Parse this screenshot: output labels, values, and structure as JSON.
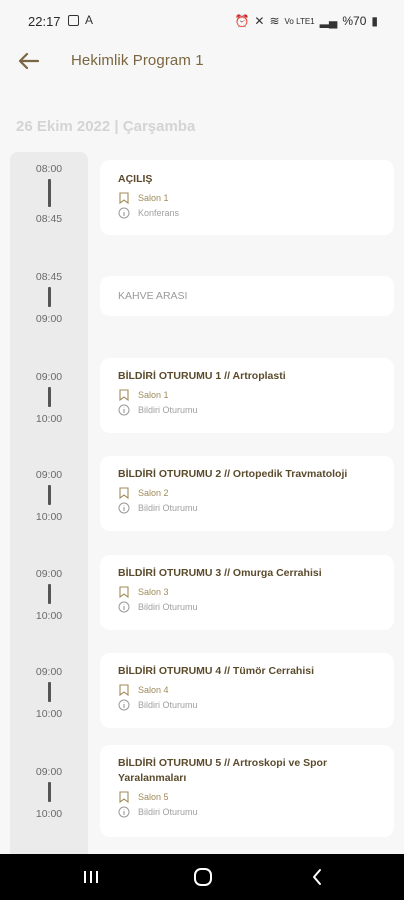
{
  "status": {
    "time": "22:17",
    "letter": "A",
    "net": "Vo LTE1",
    "battery": "%70"
  },
  "header": {
    "title": "Hekimlik Program 1"
  },
  "date_header": "26 Ekim 2022 | Çarşamba",
  "sessions": [
    {
      "start": "08:00",
      "end": "08:45",
      "title": "AÇILIŞ",
      "salon": "Salon 1",
      "type": "Konferans"
    },
    {
      "start": "08:45",
      "end": "09:00",
      "title": "KAHVE ARASI"
    },
    {
      "start": "09:00",
      "end": "10:00",
      "title": "BİLDİRİ OTURUMU 1 // Artroplasti",
      "salon": "Salon 1",
      "type": "Bildiri Oturumu"
    },
    {
      "start": "09:00",
      "end": "10:00",
      "title": "BİLDİRİ OTURUMU 2 // Ortopedik Travmatoloji",
      "salon": "Salon 2",
      "type": "Bildiri Oturumu"
    },
    {
      "start": "09:00",
      "end": "10:00",
      "title": "BİLDİRİ OTURUMU 3 // Omurga Cerrahisi",
      "salon": "Salon 3",
      "type": "Bildiri Oturumu"
    },
    {
      "start": "09:00",
      "end": "10:00",
      "title": "BİLDİRİ OTURUMU 4 // Tümör Cerrahisi",
      "salon": "Salon 4",
      "type": "Bildiri Oturumu"
    },
    {
      "start": "09:00",
      "end": "10:00",
      "title": "BİLDİRİ OTURUMU 5 // Artroskopi ve Spor Yaralanmaları",
      "salon": "Salon 5",
      "type": "Bildiri Oturumu"
    }
  ],
  "colors": {
    "accent": "#7a6640",
    "title_text": "#5b4b2d",
    "salon_text": "#a08a5a"
  },
  "icons": {
    "back": "arrow-left-icon",
    "salon": "bookmark-icon",
    "type": "info-icon"
  }
}
